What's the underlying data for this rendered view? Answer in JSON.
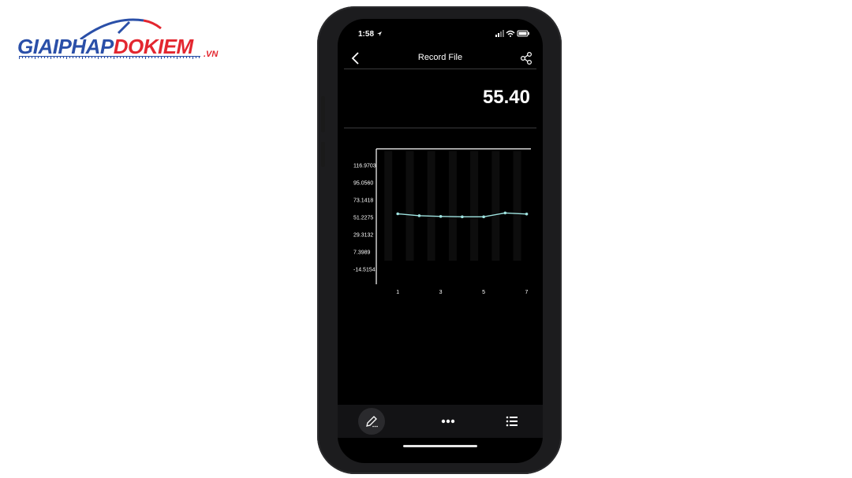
{
  "logo": {
    "part1": "GIAIPHAP",
    "part2": "DOKIEM",
    "suffix": ".VN"
  },
  "status_bar": {
    "time": "1:58"
  },
  "header": {
    "title": "Record File"
  },
  "reading": {
    "value": "55.40"
  },
  "chart_data": {
    "type": "line",
    "ytick_labels": [
      "116.9703",
      "95.0560",
      "73.1418",
      "51.2275",
      "29.3132",
      "7.3989",
      "-14.5154"
    ],
    "xtick_labels": [
      "1",
      "3",
      "5",
      "7"
    ],
    "x": [
      1,
      2,
      3,
      4,
      5,
      6,
      7
    ],
    "values": [
      55.7,
      53.3,
      52.4,
      51.9,
      51.9,
      56.8,
      55.4
    ],
    "ylim": [
      -14.5154,
      116.9703
    ],
    "xlim": [
      0,
      7.2
    ],
    "line_color": "#9fe3e0"
  },
  "toolbar": {
    "edit_icon": "pencil-icon",
    "more_icon": "more-dots-icon",
    "list_icon": "list-icon"
  },
  "colors": {
    "logo_blue": "#2a4fa8",
    "logo_red": "#e3262f"
  }
}
